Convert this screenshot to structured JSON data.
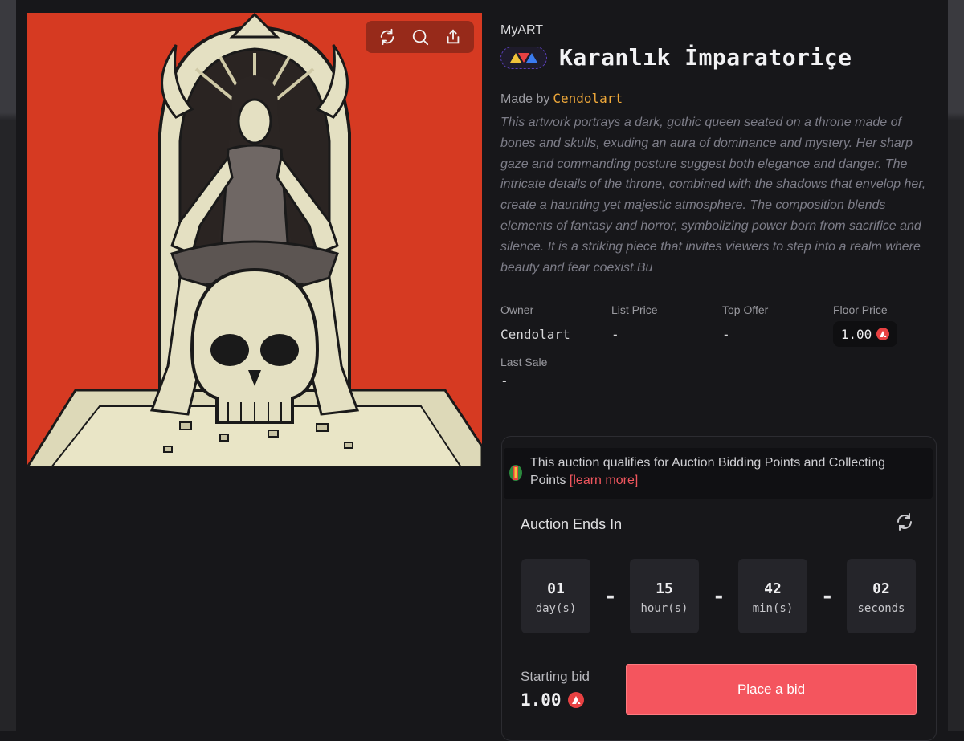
{
  "nft": {
    "collection": "MyART",
    "title": "Karanlık İmparatoriçe",
    "made_by_label": "Made by",
    "creator": "Cendolart",
    "description": "This artwork portrays a dark, gothic queen seated on a throne made of bones and skulls, exuding an aura of dominance and mystery. Her sharp gaze and commanding posture suggest both elegance and danger. The intricate details of the throne, combined with the shadows that envelop her, create a haunting yet majestic atmosphere. The composition blends elements of fantasy and horror, symbolizing power born from sacrifice and silence. It is a striking piece that invites viewers to step into a realm where beauty and fear coexist.Bu"
  },
  "artwork_tools": [
    {
      "icon": "refresh-icon"
    },
    {
      "icon": "search-icon"
    },
    {
      "icon": "share-icon"
    }
  ],
  "stats": {
    "owner_label": "Owner",
    "owner_value": "Cendolart",
    "list_price_label": "List Price",
    "list_price_value": "-",
    "top_offer_label": "Top Offer",
    "top_offer_value": "-",
    "floor_price_label": "Floor Price",
    "floor_price_value": "1.00",
    "last_sale_label": "Last Sale",
    "last_sale_value": "-"
  },
  "auction": {
    "points_text": "This auction qualifies for Auction Bidding Points and Collecting Points",
    "learn_more": "[learn more]",
    "ends_label": "Auction Ends In",
    "countdown": [
      {
        "value": "01",
        "unit": "day(s)"
      },
      {
        "value": "15",
        "unit": "hour(s)"
      },
      {
        "value": "42",
        "unit": "min(s)"
      },
      {
        "value": "02",
        "unit": "seconds"
      }
    ],
    "separator": "-",
    "starting_bid_label": "Starting bid",
    "starting_bid_value": "1.00",
    "bid_button": "Place a bid"
  },
  "colors": {
    "accent": "#f4555e",
    "creator": "#f0a93a",
    "artwork_bg": "#d63a22",
    "avax_red": "#e84142"
  }
}
